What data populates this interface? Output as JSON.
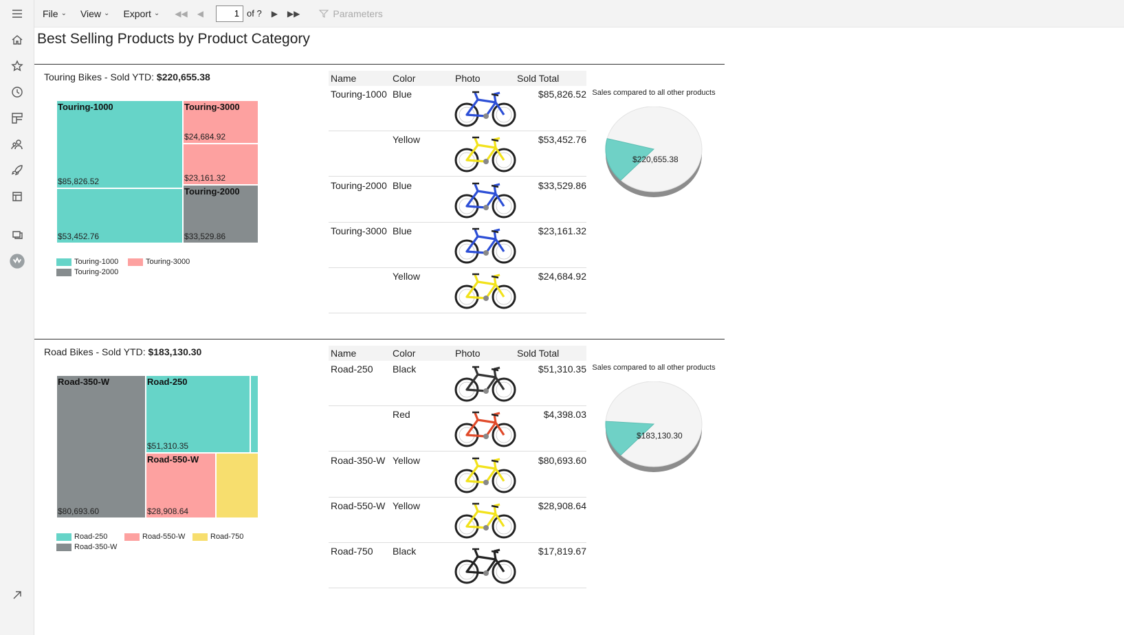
{
  "toolbar": {
    "file": "File",
    "view": "View",
    "export": "Export",
    "page_value": "1",
    "page_of": "of ?",
    "parameters": "Parameters"
  },
  "report": {
    "title": "Best Selling Products by Product Category",
    "sections": [
      {
        "category": "Touring Bikes",
        "sold_prefix": "Touring Bikes - Sold YTD: ",
        "sold_total": "$220,655.38",
        "treemap": {
          "cells": [
            {
              "name": "Touring-1000",
              "value": "$85,826.52",
              "color": "#66d4c8"
            },
            {
              "name": "",
              "value": "$53,452.76",
              "color": "#66d4c8"
            },
            {
              "name": "Touring-3000",
              "value": "$24,684.92",
              "color": "#fda1a0"
            },
            {
              "name": "",
              "value": "$23,161.32",
              "color": "#fda1a0"
            },
            {
              "name": "Touring-2000",
              "value": "$33,529.86",
              "color": "#868c8e"
            }
          ],
          "legend": [
            {
              "label": "Touring-1000",
              "color": "#66d4c8"
            },
            {
              "label": "Touring-3000",
              "color": "#fda1a0"
            },
            {
              "label": "Touring-2000",
              "color": "#868c8e"
            }
          ]
        },
        "table": {
          "headers": [
            "Name",
            "Color",
            "Photo",
            "Sold Total"
          ],
          "rows": [
            {
              "name": "Touring-1000",
              "color": "Blue",
              "bike_color": "#2d4fd6",
              "total": "$85,826.52"
            },
            {
              "name": "",
              "color": "Yellow",
              "bike_color": "#f2e21b",
              "total": "$53,452.76"
            },
            {
              "name": "Touring-2000",
              "color": "Blue",
              "bike_color": "#2d4fd6",
              "total": "$33,529.86"
            },
            {
              "name": "Touring-3000",
              "color": "Blue",
              "bike_color": "#2d4fd6",
              "total": "$23,161.32"
            },
            {
              "name": "",
              "color": "Yellow",
              "bike_color": "#f2e21b",
              "total": "$24,684.92"
            }
          ]
        },
        "pie": {
          "label": "Sales compared to all other products",
          "value_label": "$220,655.38",
          "share": 0.17
        }
      },
      {
        "category": "Road Bikes",
        "sold_prefix": "Road Bikes - Sold YTD: ",
        "sold_total": "$183,130.30",
        "treemap": {
          "cells": [
            {
              "name": "Road-350-W",
              "value": "$80,693.60",
              "color": "#868c8e"
            },
            {
              "name": "Road-250",
              "value": "$51,310.35",
              "color": "#66d4c8"
            },
            {
              "name": "",
              "value": "",
              "color": "#66d4c8"
            },
            {
              "name": "Road-550-W",
              "value": "$28,908.64",
              "color": "#fda1a0"
            },
            {
              "name": "",
              "value": "",
              "color": "#f7de6e"
            }
          ],
          "legend": [
            {
              "label": "Road-250",
              "color": "#66d4c8"
            },
            {
              "label": "Road-550-W",
              "color": "#fda1a0"
            },
            {
              "label": "Road-750",
              "color": "#f7de6e"
            },
            {
              "label": "Road-350-W",
              "color": "#868c8e"
            }
          ]
        },
        "table": {
          "headers": [
            "Name",
            "Color",
            "Photo",
            "Sold Total"
          ],
          "rows": [
            {
              "name": "Road-250",
              "color": "Black",
              "bike_color": "#333333",
              "total": "$51,310.35"
            },
            {
              "name": "",
              "color": "Red",
              "bike_color": "#e04a2a",
              "total": "$4,398.03"
            },
            {
              "name": "Road-350-W",
              "color": "Yellow",
              "bike_color": "#f2e21b",
              "total": "$80,693.60"
            },
            {
              "name": "Road-550-W",
              "color": "Yellow",
              "bike_color": "#f2e21b",
              "total": "$28,908.64"
            },
            {
              "name": "Road-750",
              "color": "Black",
              "bike_color": "#222222",
              "total": "$17,819.67"
            }
          ]
        },
        "pie": {
          "label": "Sales compared to all other products",
          "value_label": "$183,130.30",
          "share": 0.14
        }
      }
    ]
  }
}
